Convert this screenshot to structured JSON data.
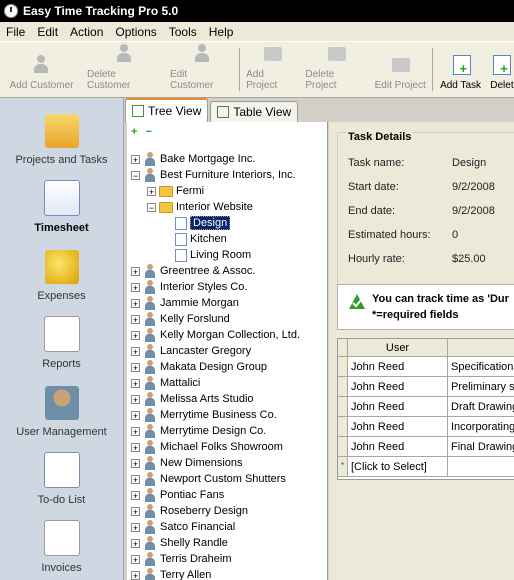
{
  "window": {
    "title": "Easy Time Tracking Pro 5.0"
  },
  "menu": [
    "File",
    "Edit",
    "Action",
    "Options",
    "Tools",
    "Help"
  ],
  "toolbar": {
    "add_customer": "Add Customer",
    "delete_customer": "Delete Customer",
    "edit_customer": "Edit Customer",
    "add_project": "Add Project",
    "delete_project": "Delete Project",
    "edit_project": "Edit Project",
    "add_task": "Add Task",
    "delete_partial": "Delete"
  },
  "nav": {
    "projects": "Projects and Tasks",
    "timesheet": "Timesheet",
    "expenses": "Expenses",
    "reports": "Reports",
    "user_management": "User Management",
    "todo": "To-do List",
    "invoices": "Invoices"
  },
  "tabs": {
    "tree": "Tree View",
    "table": "Table View"
  },
  "tree": {
    "customers_top": [
      "Bake Mortgage Inc.",
      "Best Furniture Interiors, Inc."
    ],
    "projects": [
      "Fermi",
      "Interior Website"
    ],
    "tasks": [
      "Design",
      "Kitchen",
      "Living Room"
    ],
    "customers": [
      "Greentree & Assoc.",
      "Interior Styles Co.",
      "Jammie Morgan",
      "Kelly Forslund",
      "Kelly Morgan Collection, Ltd.",
      "Lancaster Gregory",
      "Makata Design Group",
      "Mattalici",
      "Melissa Arts Studio",
      "Merrytime Business Co.",
      "Merrytime Design Co.",
      "Michael Folks Showroom",
      "New Dimensions",
      "Newport Custom Shutters",
      "Pontiac Fans",
      "Roseberry Design",
      "Satco Financial",
      "Shelly Randle",
      "Terris Draheim",
      "Terry Allen"
    ]
  },
  "details": {
    "group_title": "Task Details",
    "labels": {
      "task_name": "Task name:",
      "start_date": "Start date:",
      "end_date": "End date:",
      "estimated_hours": "Estimated hours:",
      "hourly_rate": "Hourly rate:"
    },
    "values": {
      "task_name": "Design",
      "start_date": "9/2/2008",
      "end_date": "9/2/2008",
      "estimated_hours": "0",
      "hourly_rate": "$25.00"
    },
    "notice_line1": "You can track time as 'Dur",
    "notice_line2": "*=required fields"
  },
  "grid": {
    "header_user": "User",
    "rows": [
      {
        "user": "John Reed",
        "desc": "Specifications"
      },
      {
        "user": "John Reed",
        "desc": "Preliminary sk"
      },
      {
        "user": "John Reed",
        "desc": "Draft Drawing"
      },
      {
        "user": "John Reed",
        "desc": "Incorporating"
      },
      {
        "user": "John Reed",
        "desc": "Final Drawing"
      }
    ],
    "new_row": "[Click to Select]",
    "new_row_marker": "*"
  }
}
